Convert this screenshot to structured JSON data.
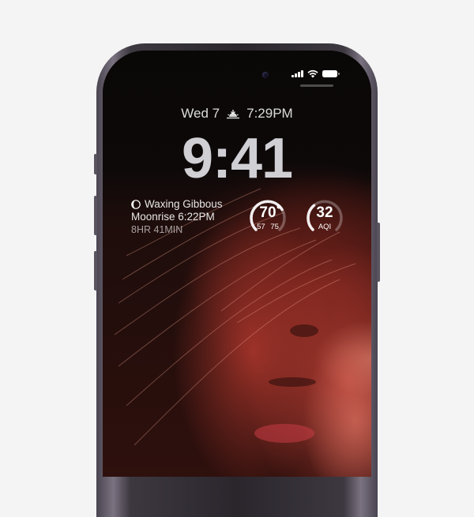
{
  "status": {
    "icons": [
      "signal-icon",
      "wifi-icon",
      "battery-icon"
    ]
  },
  "lock_screen": {
    "date": "Wed 7",
    "sunset_icon": "sunset-icon",
    "sunset_time": "7:29PM",
    "time": "9:41"
  },
  "moon_widget": {
    "icon": "moon-phase-icon",
    "phase": "Waxing Gibbous",
    "moonrise": "Moonrise 6:22PM",
    "duration": "8HR 41MIN"
  },
  "weather_widget": {
    "temperature": "70",
    "low_high": "57 75",
    "level": 0.72
  },
  "aqi_widget": {
    "value": "32",
    "label": "AQI",
    "level": 0.35
  },
  "colors": {
    "frame": "#2a262c",
    "wallpaper_accent": "#b43c32",
    "background": "#f4f4f4"
  }
}
